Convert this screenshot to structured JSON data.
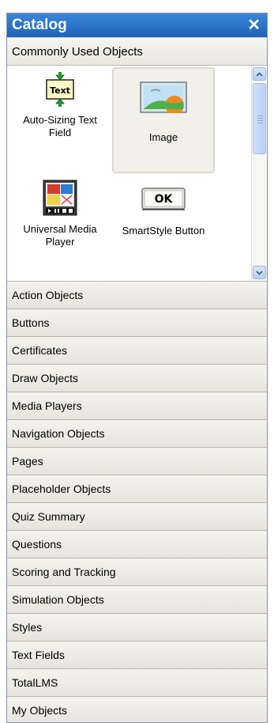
{
  "panel": {
    "title": "Catalog"
  },
  "group": {
    "label": "Commonly Used Objects"
  },
  "items": [
    {
      "label_line1": "Auto-Sizing Text",
      "label_line2": "Field",
      "icon_text": "Text"
    },
    {
      "label_line1": "Image"
    },
    {
      "label_line1": "Universal Media",
      "label_line2": "Player"
    },
    {
      "label_line1": "SmartStyle Button",
      "icon_text": "OK"
    }
  ],
  "categories": [
    "Action Objects",
    "Buttons",
    "Certificates",
    "Draw Objects",
    "Media Players",
    "Navigation Objects",
    "Pages",
    "Placeholder Objects",
    "Quiz Summary",
    "Questions",
    "Scoring and Tracking",
    "Simulation Objects",
    "Styles",
    "Text Fields",
    "TotalLMS",
    "My Objects"
  ]
}
